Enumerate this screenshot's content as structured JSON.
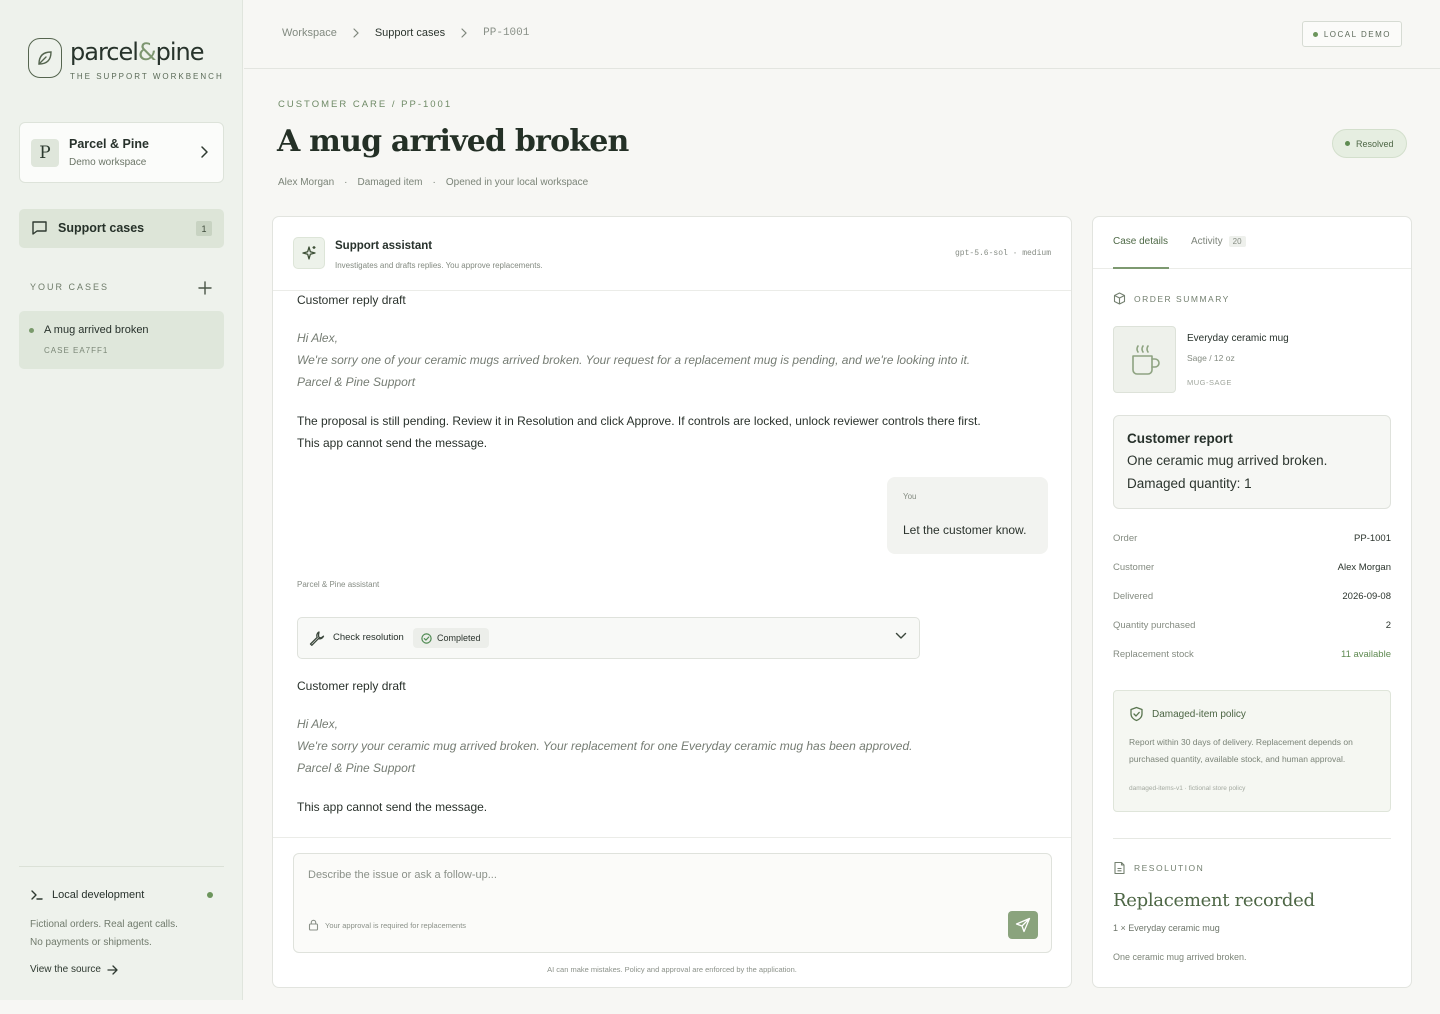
{
  "brand": {
    "name_left": "parcel",
    "amp": "&",
    "name_right": "pine",
    "tagline": "THE SUPPORT WORKBENCH"
  },
  "workspace": {
    "initial": "P",
    "name": "Parcel & Pine",
    "subtitle": "Demo workspace"
  },
  "nav": {
    "support_label": "Support cases",
    "support_count": "1"
  },
  "cases": {
    "heading": "YOUR CASES",
    "items": [
      {
        "title": "A mug arrived broken",
        "id": "CASE EA7FF1"
      }
    ]
  },
  "footer": {
    "local_dev": "Local development",
    "note_line1": "Fictional orders. Real agent calls.",
    "note_line2": "No payments or shipments.",
    "view_source": "View the source"
  },
  "breadcrumb": {
    "workspace": "Workspace",
    "support": "Support cases",
    "order": "PP-1001"
  },
  "local_demo": "LOCAL DEMO",
  "header": {
    "eyebrow": "CUSTOMER CARE / PP-1001",
    "title": "A mug arrived broken",
    "status": "Resolved",
    "meta": {
      "customer": "Alex Morgan",
      "type": "Damaged item",
      "opened": "Opened in your local workspace"
    }
  },
  "assistant": {
    "name": "Support assistant",
    "subtitle": "Investigates and drafts replies. You approve replacements.",
    "model": "gpt-5.6-sol · medium"
  },
  "conversation": {
    "draft1": {
      "heading": "Customer reply draft",
      "greeting": "Hi Alex,",
      "body": "We're sorry one of your ceramic mugs arrived broken. Your request for a replacement mug is pending, and we're looking into it.",
      "signoff": "Parcel & Pine Support",
      "note1": "The proposal is still pending. Review it in Resolution and click Approve. If controls are locked, unlock reviewer controls there first.",
      "note2": "This app cannot send the message."
    },
    "user": {
      "label": "You",
      "message": "Let the customer know."
    },
    "assistant_label": "Parcel & Pine assistant",
    "tool": {
      "label": "Check resolution",
      "status": "Completed"
    },
    "draft2": {
      "heading": "Customer reply draft",
      "greeting": "Hi Alex,",
      "body": "We're sorry your ceramic mug arrived broken. Your replacement for one Everyday ceramic mug has been approved.",
      "signoff": "Parcel & Pine Support",
      "note": "This app cannot send the message."
    }
  },
  "composer": {
    "placeholder": "Describe the issue or ask a follow-up...",
    "approval_note": "Your approval is required for replacements",
    "disclaimer": "AI can make mistakes. Policy and approval are enforced by the application."
  },
  "details": {
    "tab_details": "Case details",
    "tab_activity": "Activity",
    "activity_count": "20",
    "order_summary": "ORDER SUMMARY",
    "product": {
      "name": "Everyday ceramic mug",
      "variant": "Sage / 12 oz",
      "sku": "MUG-SAGE"
    },
    "report": {
      "heading": "Customer report",
      "line1": "One ceramic mug arrived broken.",
      "line2": "Damaged quantity: 1"
    },
    "rows": [
      {
        "k": "Order",
        "v": "PP-1001"
      },
      {
        "k": "Customer",
        "v": "Alex Morgan"
      },
      {
        "k": "Delivered",
        "v": "2026-09-08"
      },
      {
        "k": "Quantity purchased",
        "v": "2"
      },
      {
        "k": "Replacement stock",
        "v": "11 available"
      }
    ],
    "policy": {
      "title": "Damaged-item policy",
      "body": "Report within 30 days of delivery. Replacement depends on purchased quantity, available stock, and human approval.",
      "footer": "damaged-items-v1 · fictional store policy"
    },
    "resolution": {
      "heading": "RESOLUTION",
      "title": "Replacement recorded",
      "item": "1 × Everyday ceramic mug",
      "note": "One ceramic mug arrived broken."
    }
  }
}
